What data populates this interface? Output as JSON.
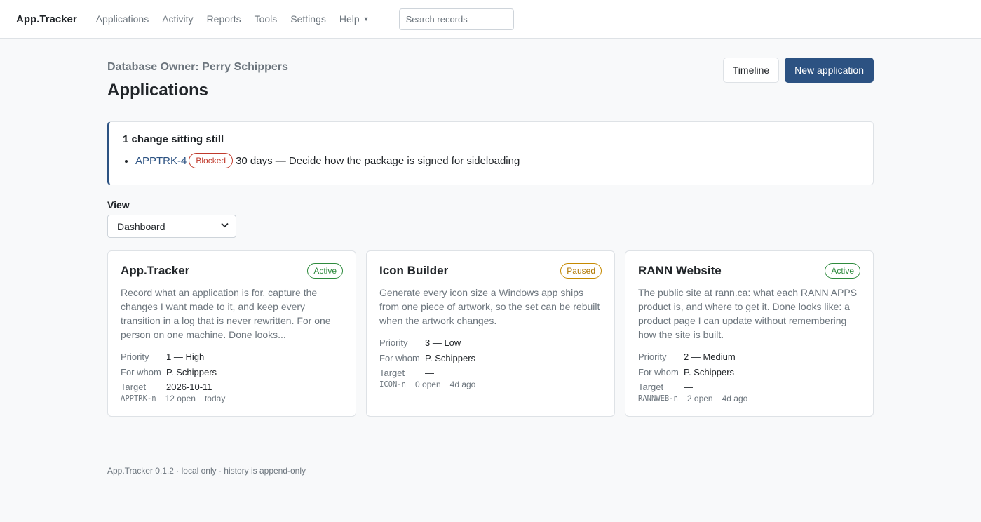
{
  "nav": {
    "brand": "App.Tracker",
    "items": [
      "Applications",
      "Activity",
      "Reports",
      "Tools",
      "Settings"
    ],
    "help": "Help",
    "search_placeholder": "Search records"
  },
  "header": {
    "owner": "Database Owner: Perry Schippers",
    "title": "Applications",
    "timeline_button": "Timeline",
    "new_button": "New application"
  },
  "alert": {
    "title": "1 change sitting still",
    "items": [
      {
        "id": "APPTRK-4",
        "badge": "Blocked",
        "text": "30 days — Decide how the package is signed for sideloading"
      }
    ]
  },
  "view": {
    "label": "View",
    "selected": "Dashboard"
  },
  "cards": [
    {
      "title": "App.Tracker",
      "status": "Active",
      "description": "Record what an application is for, capture the changes I want made to it, and keep every transition in a log that is never rewritten. For one person on one machine. Done looks...",
      "priority_label": "Priority",
      "priority": "1 — High",
      "whom_label": "For whom",
      "whom": "P. Schippers",
      "target_label": "Target",
      "target": "2026-10-11",
      "code": "APPTRK-n",
      "open": "12 open",
      "updated": "today"
    },
    {
      "title": "Icon Builder",
      "status": "Paused",
      "description": "Generate every icon size a Windows app ships from one piece of artwork, so the set can be rebuilt when the artwork changes.",
      "priority_label": "Priority",
      "priority": "3 — Low",
      "whom_label": "For whom",
      "whom": "P. Schippers",
      "target_label": "Target",
      "target": "—",
      "code": "ICON-n",
      "open": "0 open",
      "updated": "4d ago"
    },
    {
      "title": "RANN Website",
      "status": "Active",
      "description": "The public site at rann.ca: what each RANN APPS product is, and where to get it. Done looks like: a product page I can update without remembering how the site is built.",
      "priority_label": "Priority",
      "priority": "2 — Medium",
      "whom_label": "For whom",
      "whom": "P. Schippers",
      "target_label": "Target",
      "target": "—",
      "code": "RANNWEB-n",
      "open": "2 open",
      "updated": "4d ago"
    }
  ],
  "footer": "App.Tracker 0.1.2 · local only · history is append-only",
  "colors": {
    "primary": "#2c5282",
    "active": "#2e8b3d",
    "paused": "#c68a00",
    "blocked": "#c0392b"
  }
}
